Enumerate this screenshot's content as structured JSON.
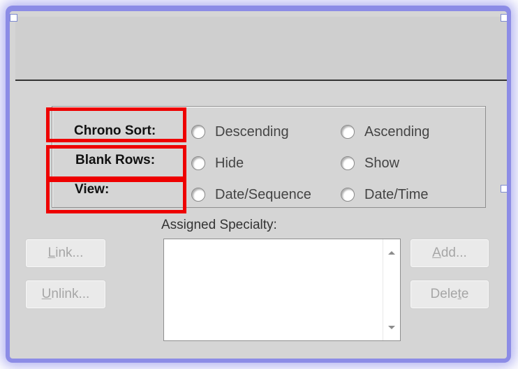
{
  "options": {
    "chrono_sort": {
      "label": "Chrono Sort:",
      "option_1": "Descending",
      "option_2": "Ascending"
    },
    "blank_rows": {
      "label": "Blank Rows:",
      "option_1": "Hide",
      "option_2": "Show"
    },
    "view": {
      "label": "View:",
      "option_1": "Date/Sequence",
      "option_2": "Date/Time"
    }
  },
  "specialty": {
    "caption": "Assigned Specialty:"
  },
  "buttons": {
    "link": {
      "mnemonic": "L",
      "rest": "ink..."
    },
    "unlink": {
      "mnemonic": "U",
      "rest": "nlink..."
    },
    "add": {
      "mnemonic": "A",
      "rest": "dd..."
    },
    "delete": {
      "before": "Dele",
      "mnemonic": "t",
      "after": "e"
    }
  },
  "colors": {
    "frame_glow": "#8c8ce6",
    "dialog_bg": "#d5d5d5",
    "highlight_red": "#ee0000",
    "disabled_text": "#a6a6a6"
  }
}
